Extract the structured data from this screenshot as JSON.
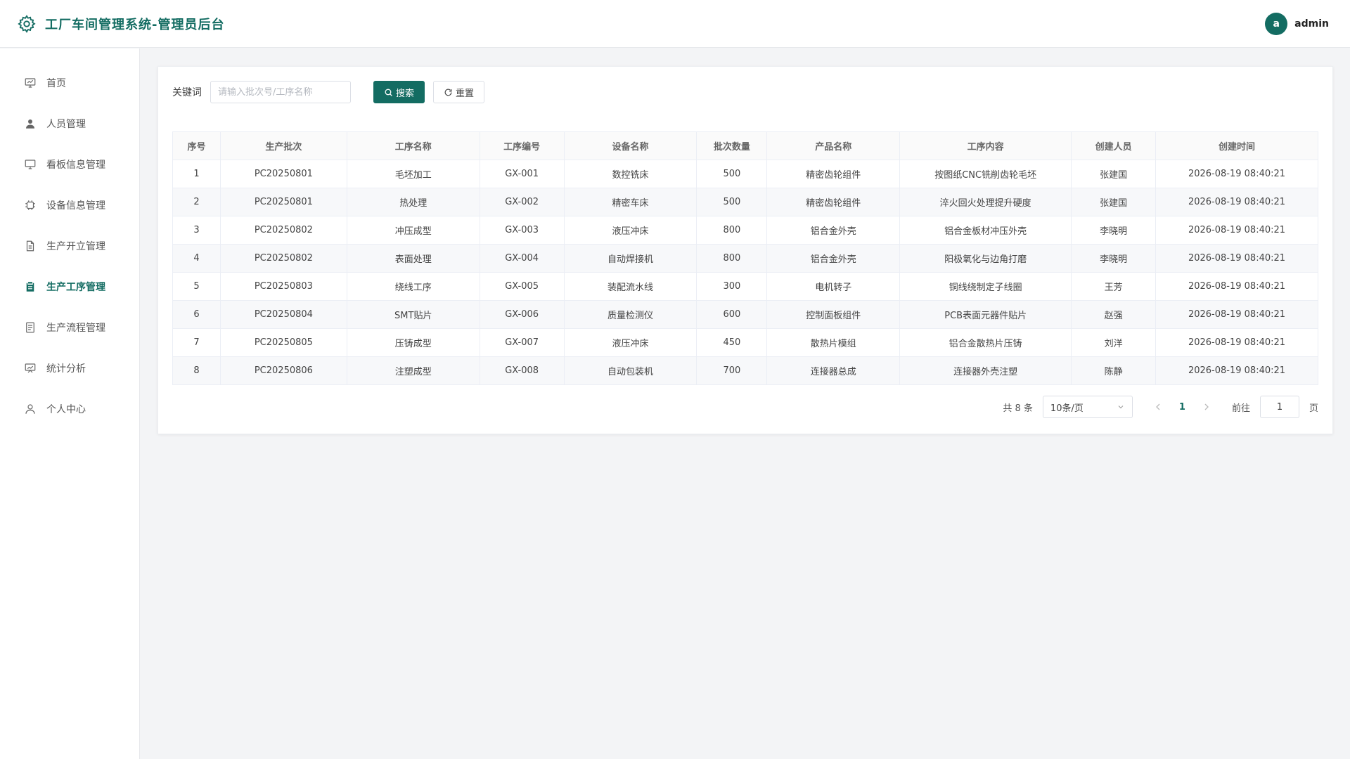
{
  "app": {
    "title": "工厂车间管理系统-管理员后台"
  },
  "user": {
    "avatar_letter": "a",
    "name": "admin"
  },
  "sidebar": {
    "items": [
      {
        "label": "首页",
        "icon": "presentation-chart-icon",
        "active": false
      },
      {
        "label": "人员管理",
        "icon": "user-solid-icon",
        "active": false
      },
      {
        "label": "看板信息管理",
        "icon": "monitor-icon",
        "active": false
      },
      {
        "label": "设备信息管理",
        "icon": "chip-icon",
        "active": false
      },
      {
        "label": "生产开立管理",
        "icon": "document-icon",
        "active": false
      },
      {
        "label": "生产工序管理",
        "icon": "clipboard-icon",
        "active": true
      },
      {
        "label": "生产流程管理",
        "icon": "list-document-icon",
        "active": false
      },
      {
        "label": "统计分析",
        "icon": "chart-board-icon",
        "active": false
      },
      {
        "label": "个人中心",
        "icon": "user-outline-icon",
        "active": false
      }
    ]
  },
  "search": {
    "label": "关键词",
    "placeholder": "请输入批次号/工序名称",
    "value": "",
    "search_button": "搜索",
    "reset_button": "重置"
  },
  "table": {
    "headers": [
      "序号",
      "生产批次",
      "工序名称",
      "工序编号",
      "设备名称",
      "批次数量",
      "产品名称",
      "工序内容",
      "创建人员",
      "创建时间"
    ],
    "rows": [
      [
        "1",
        "PC20250801",
        "毛坯加工",
        "GX-001",
        "数控铣床",
        "500",
        "精密齿轮组件",
        "按图纸CNC铣削齿轮毛坯",
        "张建国",
        "2026-08-19 08:40:21"
      ],
      [
        "2",
        "PC20250801",
        "热处理",
        "GX-002",
        "精密车床",
        "500",
        "精密齿轮组件",
        "淬火回火处理提升硬度",
        "张建国",
        "2026-08-19 08:40:21"
      ],
      [
        "3",
        "PC20250802",
        "冲压成型",
        "GX-003",
        "液压冲床",
        "800",
        "铝合金外壳",
        "铝合金板材冲压外壳",
        "李晓明",
        "2026-08-19 08:40:21"
      ],
      [
        "4",
        "PC20250802",
        "表面处理",
        "GX-004",
        "自动焊接机",
        "800",
        "铝合金外壳",
        "阳极氧化与边角打磨",
        "李晓明",
        "2026-08-19 08:40:21"
      ],
      [
        "5",
        "PC20250803",
        "绕线工序",
        "GX-005",
        "装配流水线",
        "300",
        "电机转子",
        "铜线绕制定子线圈",
        "王芳",
        "2026-08-19 08:40:21"
      ],
      [
        "6",
        "PC20250804",
        "SMT贴片",
        "GX-006",
        "质量检测仪",
        "600",
        "控制面板组件",
        "PCB表面元器件贴片",
        "赵强",
        "2026-08-19 08:40:21"
      ],
      [
        "7",
        "PC20250805",
        "压铸成型",
        "GX-007",
        "液压冲床",
        "450",
        "散热片模组",
        "铝合金散热片压铸",
        "刘洋",
        "2026-08-19 08:40:21"
      ],
      [
        "8",
        "PC20250806",
        "注塑成型",
        "GX-008",
        "自动包装机",
        "700",
        "连接器总成",
        "连接器外壳注塑",
        "陈静",
        "2026-08-19 08:40:21"
      ]
    ]
  },
  "pagination": {
    "total_text": "共 8 条",
    "page_size": "10条/页",
    "current_page": "1",
    "goto_label": "前往",
    "goto_value": "1",
    "page_suffix": "页"
  },
  "colors": {
    "accent": "#136c62"
  }
}
